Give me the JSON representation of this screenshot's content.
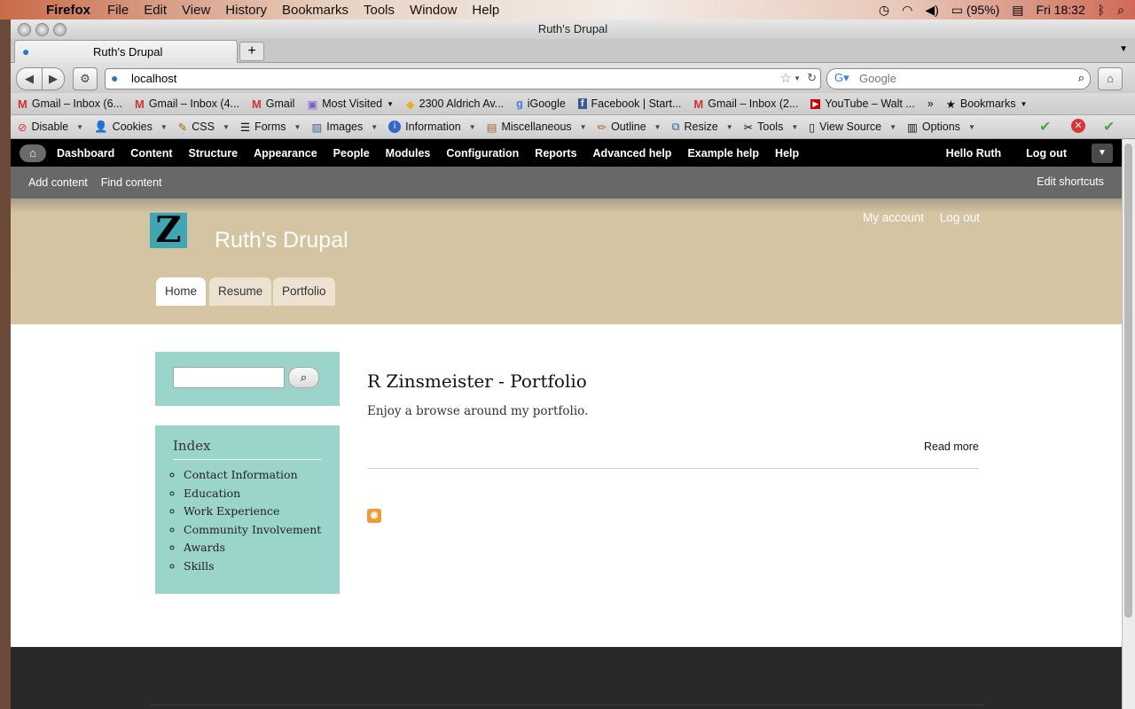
{
  "os_menubar": {
    "app": "Firefox",
    "menus": [
      "File",
      "Edit",
      "View",
      "History",
      "Bookmarks",
      "Tools",
      "Window",
      "Help"
    ],
    "battery": "(95%)",
    "clock": "Fri 18:32"
  },
  "browser": {
    "window_title": "Ruth's Drupal",
    "tab_title": "Ruth's Drupal",
    "url": "localhost",
    "search_placeholder": "Google",
    "bookmarks": [
      "Gmail – Inbox (6...",
      "Gmail – Inbox (4...",
      "Gmail",
      "Most Visited",
      "2300 Aldrich Av...",
      "iGoogle",
      "Facebook | Start...",
      "Gmail – Inbox (2...",
      "YouTube – Walt ..."
    ],
    "bookmarks_menu": "Bookmarks",
    "devtools": [
      "Disable",
      "Cookies",
      "CSS",
      "Forms",
      "Images",
      "Information",
      "Miscellaneous",
      "Outline",
      "Resize",
      "Tools",
      "View Source",
      "Options"
    ]
  },
  "admin_toolbar": {
    "items": [
      "Dashboard",
      "Content",
      "Structure",
      "Appearance",
      "People",
      "Modules",
      "Configuration",
      "Reports",
      "Advanced help",
      "Example help",
      "Help"
    ],
    "greeting": "Hello Ruth",
    "logout": "Log out",
    "shortcuts": [
      "Add content",
      "Find content"
    ],
    "edit_shortcuts": "Edit shortcuts"
  },
  "site": {
    "logo_letter": "Z",
    "name": "Ruth's Drupal",
    "secondary": [
      "My account",
      "Log out"
    ],
    "tabs": [
      "Home",
      "Resume",
      "Portfolio"
    ],
    "index_title": "Index",
    "index_items": [
      "Contact Information",
      "Education",
      "Work Experience",
      "Community Involvement",
      "Awards",
      "Skills"
    ],
    "node_title": "R Zinsmeister - Portfolio",
    "node_body": "Enjoy a browse around my portfolio.",
    "read_more": "Read more"
  },
  "colors": {
    "sidebar_block": "#9bd4cb",
    "header_bg": "#d6c5a3",
    "footer_bg": "#292929"
  }
}
